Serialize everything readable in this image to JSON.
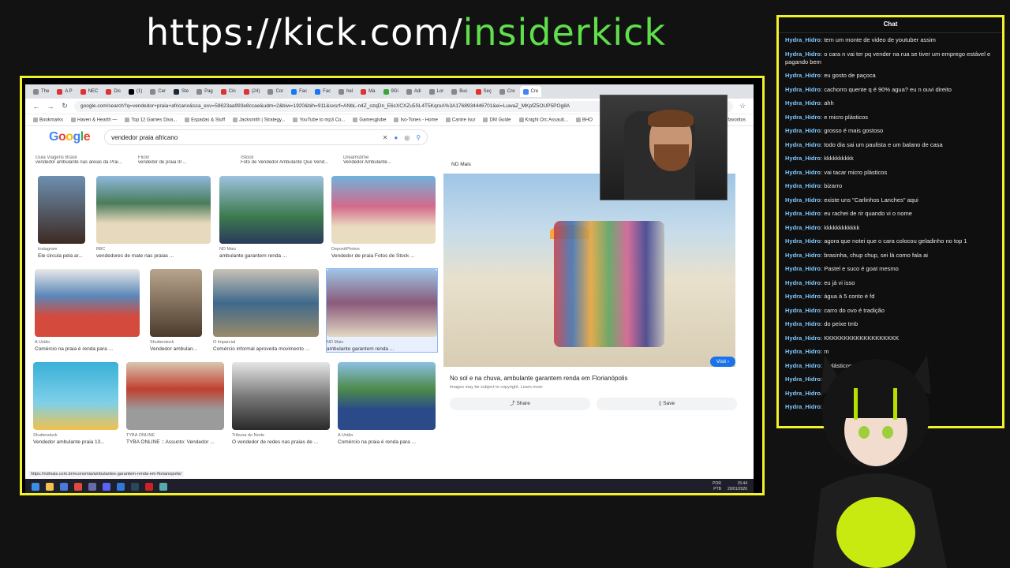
{
  "banner": {
    "prefix": "https://kick.com/",
    "channel": "insiderkick"
  },
  "browser": {
    "tabs": [
      "The",
      "A P",
      "NEC",
      "Dis",
      "(1)",
      "Cer",
      "Ste",
      "Pag",
      "Cin",
      "(24)",
      "Cor",
      "Fac",
      "Fac",
      "hel",
      "Ma",
      "9Gi",
      "Adi",
      "Lor",
      "Buc",
      "Seç",
      "Cre",
      "Cre"
    ],
    "address": "google.com/search?q=vendedor+praia+africano&sca_esv=59623aa993e8ccae&udm=2&biw=1920&bih=911&sxsrf=ANbL-n4Z_ozqDn_E6cXCXZu5SL4T5KqroA%3A1768934446701&ei=LuwaZ_MKpfZ5OUP5POg8A",
    "bookmarks": [
      "Bookmarks",
      "Haven & Hearth —",
      "Top 12 Games Diva...",
      "Espadas & Stuff",
      "Jacksmith | Strategy...",
      "YouTube to mp3 Co...",
      "Gamesglobe",
      "Iso-Tones - Home",
      "Cantre Isur",
      "DM Guide",
      "Knight Orc Assault...",
      "BHO",
      "favoritos"
    ]
  },
  "google": {
    "logo": "Google",
    "query": "vendedor praia africano",
    "top_captions": [
      "Guia Viagens Brasil",
      "Flickr",
      "iStock",
      "Dreamstime"
    ],
    "top_titles": [
      "vendedor ambulante nas areias da Prai...",
      "vendedor de praia III ...",
      "Foto de Vendedor Ambulante Que Vend...",
      "Vendedor Ambulante..."
    ],
    "rows": [
      [
        {
          "src": "Instagram",
          "cap": "Ele circula pela ar..."
        },
        {
          "src": "BBC",
          "cap": "vendedores de mate nas praias ..."
        },
        {
          "src": "ND Mais",
          "cap": "ambulante garantem renda ..."
        },
        {
          "src": "DepositPhotos",
          "cap": "Vendedor de praia Fotos de Stock ..."
        }
      ],
      [
        {
          "src": "A União",
          "cap": "Comércio na praia é renda para ..."
        },
        {
          "src": "Shutterstock",
          "cap": "Vendedor ambulan..."
        },
        {
          "src": "O Imparcial",
          "cap": "Comércio informal aproveita movimento ..."
        },
        {
          "src": "ND Mais",
          "cap": "ambulante garantem renda ..."
        }
      ],
      [
        {
          "src": "Shutterstock",
          "cap": "Vendedor ambulante praia 13..."
        },
        {
          "src": "TYBA ONLINE",
          "cap": "TYBA ONLINE :: Assunto: Vendedor ..."
        },
        {
          "src": "Tribuna do Norte",
          "cap": "O vendedor de redes nas praias de ..."
        },
        {
          "src": "A União",
          "cap": "Comércio na praia é renda para ..."
        }
      ]
    ],
    "detail": {
      "source": "ND Mais",
      "title": "No sol e na chuva, ambulante garantem renda em Florianópolis",
      "visit": "Visit ›",
      "notice": "Images may be subject to copyright. Learn more",
      "share": "Share",
      "save": "Save"
    },
    "status_url": "https://ndmais.com.br/economia/ambulantes-garantem-renda-em-florianopolis/"
  },
  "taskbar": {
    "lang_top": "POR",
    "lang_bottom": "PTB",
    "time": "15:44",
    "date": "20/01/2026"
  },
  "chat": {
    "title": "Chat",
    "messages": [
      {
        "user": "Hydra_Hidro",
        "text": "tem um monte de video de youtuber assim"
      },
      {
        "user": "Hydra_Hidro",
        "text": "o cara n vai ter pq vender na rua se tiver um emprego estável e pagando bem"
      },
      {
        "user": "Hydra_Hidro",
        "text": "eu gosto de paçoca"
      },
      {
        "user": "Hydra_Hidro",
        "text": "cachorro quente q é 90% agua? eu n ouvi direito"
      },
      {
        "user": "Hydra_Hidro",
        "text": "ahh"
      },
      {
        "user": "Hydra_Hidro",
        "text": "e micro plásticos"
      },
      {
        "user": "Hydra_Hidro",
        "text": "grosso é mais gostoso"
      },
      {
        "user": "Hydra_Hidro",
        "text": "todo dia sai um paulista e um balano de casa"
      },
      {
        "user": "Hydra_Hidro",
        "text": "kkkkkkkkkk"
      },
      {
        "user": "Hydra_Hidro",
        "text": "vai tacar micro plásticos"
      },
      {
        "user": "Hydra_Hidro",
        "text": "bizarro"
      },
      {
        "user": "Hydra_Hidro",
        "text": "existe uns \"Carlinhos Lanches\" aqui"
      },
      {
        "user": "Hydra_Hidro",
        "text": "eu rachei de rir quando vi o nome"
      },
      {
        "user": "Hydra_Hidro",
        "text": "kkkkkkkkkkkk"
      },
      {
        "user": "Hydra_Hidro",
        "text": "agora que notei que o cara colocou geladinho no top 1"
      },
      {
        "user": "Hydra_Hidro",
        "text": "brasinha, chup chup, sei lá como fala ai"
      },
      {
        "user": "Hydra_Hidro",
        "text": "Pastel e suco é goat mesmo"
      },
      {
        "user": "Hydra_Hidro",
        "text": "eu já vi isso"
      },
      {
        "user": "Hydra_Hidro",
        "text": "água à 5 conto é fd"
      },
      {
        "user": "Hydra_Hidro",
        "text": "carro do ovo é tradição"
      },
      {
        "user": "Hydra_Hidro",
        "text": "do peixe tmb"
      },
      {
        "user": "Hydra_Hidro",
        "text": "KKKKKKKKKKKKKKKKKKK"
      },
      {
        "user": "Hydra_Hidro",
        "text": "m"
      },
      {
        "user": "Hydra_Hidro",
        "text": "o                                    plásticos"
      },
      {
        "user": "Hydra_Hidro",
        "text": ""
      },
      {
        "user": "Hydra_Hidro",
        "text": ""
      },
      {
        "user": "Hydra_Hidro",
        "text": ""
      }
    ]
  }
}
